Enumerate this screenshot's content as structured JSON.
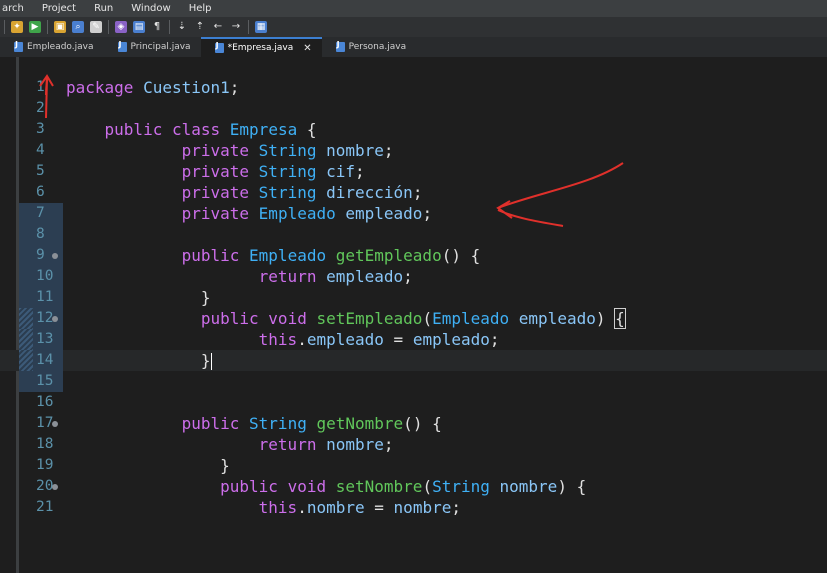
{
  "menubar": {
    "items": [
      "arch",
      "Project",
      "Run",
      "Window",
      "Help"
    ]
  },
  "toolbar": {
    "icons": [
      "new-wizard-icon",
      "run-debug-icon",
      "build-icon",
      "search-icon",
      "open-type-icon",
      "task-icon",
      "toggle-mark-icon",
      "show-whitespace-icon",
      "next-annotation-icon",
      "previous-annotation-icon",
      "back-icon",
      "forward-icon",
      "perspective-icon"
    ]
  },
  "tabs": [
    {
      "label": "Empleado.java",
      "active": false
    },
    {
      "label": "Principal.java",
      "active": false
    },
    {
      "label": "*Empresa.java",
      "active": true,
      "close": "✕"
    },
    {
      "label": "Persona.java",
      "active": false
    }
  ],
  "editor": {
    "lines": [
      {
        "n": "1",
        "text": "package Cuestion1;"
      },
      {
        "n": "2",
        "text": ""
      },
      {
        "n": "3",
        "text": "    public class Empresa {"
      },
      {
        "n": "4",
        "text": "            private String nombre;"
      },
      {
        "n": "5",
        "text": "            private String cif;"
      },
      {
        "n": "6",
        "text": "            private String dirección;"
      },
      {
        "n": "7",
        "text": "            private Empleado empleado;"
      },
      {
        "n": "8",
        "text": ""
      },
      {
        "n": "9",
        "text": "            public Empleado getEmpleado() {"
      },
      {
        "n": "10",
        "text": "                    return empleado;"
      },
      {
        "n": "11",
        "text": "              }"
      },
      {
        "n": "12",
        "text": "              public void setEmpleado(Empleado empleado) {"
      },
      {
        "n": "13",
        "text": "                    this.empleado = empleado;"
      },
      {
        "n": "14",
        "text": "              }"
      },
      {
        "n": "15",
        "text": ""
      },
      {
        "n": "16",
        "text": ""
      },
      {
        "n": "17",
        "text": "            public String getNombre() {"
      },
      {
        "n": "18",
        "text": "                    return nombre;"
      },
      {
        "n": "19",
        "text": "                }"
      },
      {
        "n": "20",
        "text": "                public void setNombre(String nombre) {"
      },
      {
        "n": "21",
        "text": "                    this.nombre = nombre;"
      }
    ]
  },
  "colors": {
    "keyword": "#cc6eea",
    "type": "#3fb0f5",
    "method": "#61c75b",
    "field": "#8ac6f7",
    "annotation": "#e0302b"
  }
}
